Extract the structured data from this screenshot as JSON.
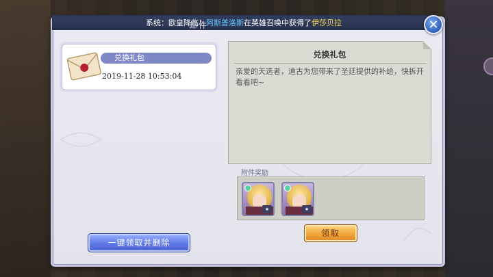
{
  "window": {
    "title": "邮件"
  },
  "ticker": {
    "prefix": "系统：欧皇降临！",
    "player": "阿斯普洛斯",
    "middle": "在英雄召唤中获得了",
    "reward": "伊莎贝拉"
  },
  "mail_list": {
    "items": [
      {
        "subject": "兑换礼包",
        "date": "2019-11-28  10:53:04"
      }
    ],
    "bulk_button_label": "一键领取并删除"
  },
  "mail_detail": {
    "title": "兑换礼包",
    "body": "亲爱的天选者，迪古为您带来了圣廷提供的补给，快拆开看看吧~",
    "rewards_label": "附件奖励",
    "rewards": [
      {
        "icon": "hero-portrait-icon"
      },
      {
        "icon": "hero-portrait-icon"
      }
    ],
    "claim_button_label": "领取"
  },
  "colors": {
    "panel_bg": "#e6e6ef",
    "accent_blue": "#5e78e6",
    "claim_orange": "#f2a63b",
    "ticker_highlight_blue": "#5ec8ff",
    "ticker_highlight_yellow": "#ffd84a"
  }
}
